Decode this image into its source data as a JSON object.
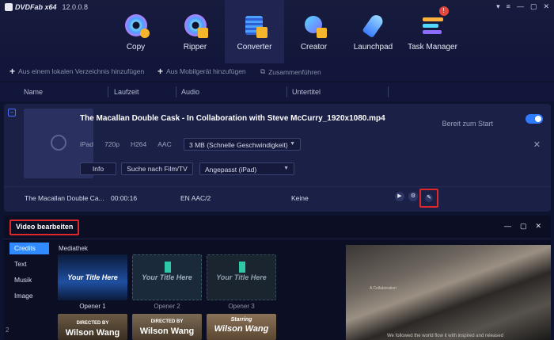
{
  "app": {
    "brand": "DVDFab x64",
    "version": "12.0.0.8"
  },
  "window_controls": [
    "pin",
    "menu",
    "minimize",
    "maximize",
    "close"
  ],
  "nav": [
    {
      "label": "Copy",
      "icon": "copy-disc-icon",
      "active": false
    },
    {
      "label": "Ripper",
      "icon": "ripper-disc-icon",
      "active": false
    },
    {
      "label": "Converter",
      "icon": "converter-film-icon",
      "active": true
    },
    {
      "label": "Creator",
      "icon": "creator-disc-icon",
      "active": false
    },
    {
      "label": "Launchpad",
      "icon": "rocket-icon",
      "active": false
    },
    {
      "label": "Task Manager",
      "icon": "task-manager-icon",
      "active": false,
      "badge": "!"
    }
  ],
  "subbar": {
    "add_local": "Aus einem lokalen Verzeichnis hinzufügen",
    "add_mobile": "Aus Mobilgerät hinzufügen",
    "merge": "Zusammenführen"
  },
  "columns": {
    "name": "Name",
    "runtime": "Laufzeit",
    "audio": "Audio",
    "subtitle": "Untertitel"
  },
  "file": {
    "title": "The Macallan Double Cask - In Collaboration with Steve McCurry_1920x1080.mp4",
    "status": "Bereit zum Start",
    "device": "iPad",
    "resolution": "720p",
    "codec": "H264",
    "audio_codec": "AAC",
    "size_option": "3 MB (Schnelle Geschwindigkeit)",
    "info_btn": "Info",
    "search_btn": "Suche nach Film/TV",
    "profile_option": "Angepasst (iPad)",
    "toggle_on": true
  },
  "track": {
    "name": "The Macallan Double Ca...",
    "duration": "00:00:16",
    "audio": "EN  AAC/2",
    "subtitle": "Keine"
  },
  "editor": {
    "title": "Video bearbeiten",
    "tabs": [
      "Credits",
      "Text",
      "Musik",
      "Image"
    ],
    "active_tab": "Credits",
    "library_label": "Mediathek",
    "tiles": [
      {
        "label": "Opener 1",
        "text": "Your Title Here"
      },
      {
        "label": "Opener 2",
        "text": "Your Title Here"
      },
      {
        "label": "Opener 3",
        "text": "Your Title Here"
      }
    ],
    "tiles_row2": [
      {
        "top": "DIRECTED BY",
        "name": "Wilson Wang"
      },
      {
        "top": "DIRECTED BY",
        "name": "Wilson Wang"
      },
      {
        "top": "Starring",
        "name": "Wilson Wang"
      }
    ],
    "side_number": "2",
    "preview_caption": "We followed the world flow it with inspired and released",
    "preview_small": "A Collaboration"
  }
}
